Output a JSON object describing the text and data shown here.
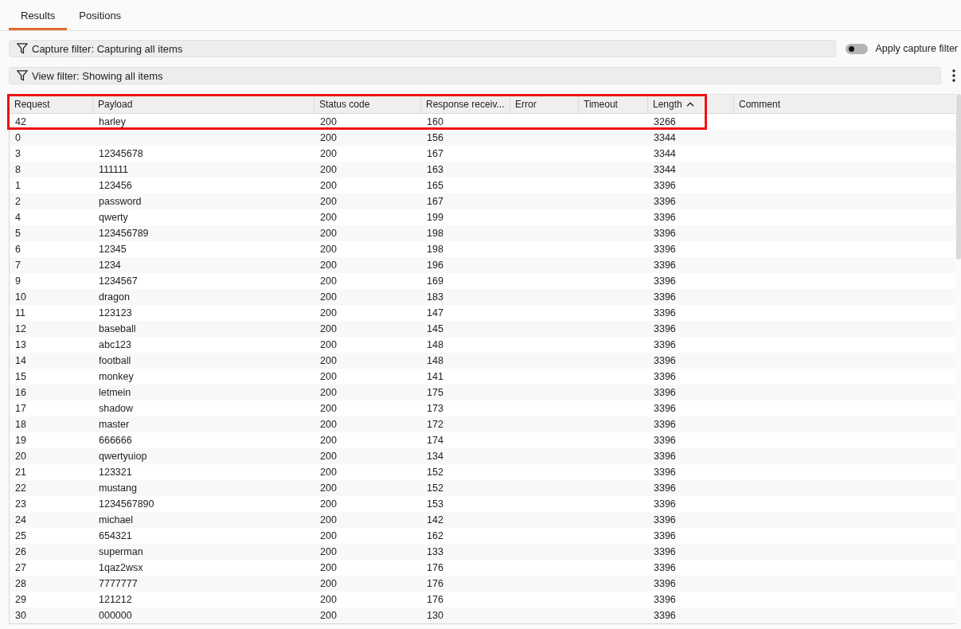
{
  "tabs": [
    {
      "label": "Results",
      "selected": true
    },
    {
      "label": "Positions",
      "selected": false
    }
  ],
  "capture_filter": {
    "label": "Capture filter: Capturing all items"
  },
  "apply_capture_filter": {
    "label": "Apply capture filter",
    "on": false
  },
  "view_filter": {
    "label": "View filter: Showing all items"
  },
  "table": {
    "columns": [
      {
        "label": "Request",
        "sorted": false
      },
      {
        "label": "Payload",
        "sorted": false
      },
      {
        "label": "Status code",
        "sorted": false
      },
      {
        "label": "Response receiv...",
        "sorted": false
      },
      {
        "label": "Error",
        "sorted": false
      },
      {
        "label": "Timeout",
        "sorted": false
      },
      {
        "label": "Length",
        "sorted": true
      },
      {
        "label": "Comment",
        "sorted": false
      }
    ],
    "rows": [
      {
        "request": "42",
        "payload": "harley",
        "status_code": "200",
        "response_received": "160",
        "length": "3266",
        "highlighted": true
      },
      {
        "request": "0",
        "status_code": "200",
        "response_received": "156",
        "length": "3344",
        "highlighted": false
      },
      {
        "request": "3",
        "payload": "12345678",
        "status_code": "200",
        "response_received": "167",
        "length": "3344",
        "highlighted": false
      },
      {
        "request": "8",
        "payload": "111111",
        "status_code": "200",
        "response_received": "163",
        "length": "3344",
        "highlighted": false
      },
      {
        "request": "1",
        "payload": "123456",
        "status_code": "200",
        "response_received": "165",
        "length": "3396",
        "highlighted": false
      },
      {
        "request": "2",
        "payload": "password",
        "status_code": "200",
        "response_received": "167",
        "length": "3396",
        "highlighted": false
      },
      {
        "request": "4",
        "payload": "qwerty",
        "status_code": "200",
        "response_received": "199",
        "length": "3396",
        "highlighted": false
      },
      {
        "request": "5",
        "payload": "123456789",
        "status_code": "200",
        "response_received": "198",
        "length": "3396",
        "highlighted": false
      },
      {
        "request": "6",
        "payload": "12345",
        "status_code": "200",
        "response_received": "198",
        "length": "3396",
        "highlighted": false
      },
      {
        "request": "7",
        "payload": "1234",
        "status_code": "200",
        "response_received": "196",
        "length": "3396",
        "highlighted": false
      },
      {
        "request": "9",
        "payload": "1234567",
        "status_code": "200",
        "response_received": "169",
        "length": "3396",
        "highlighted": false
      },
      {
        "request": "10",
        "payload": "dragon",
        "status_code": "200",
        "response_received": "183",
        "length": "3396",
        "highlighted": false
      },
      {
        "request": "11",
        "payload": "123123",
        "status_code": "200",
        "response_received": "147",
        "length": "3396",
        "highlighted": false
      },
      {
        "request": "12",
        "payload": "baseball",
        "status_code": "200",
        "response_received": "145",
        "length": "3396",
        "highlighted": false
      },
      {
        "request": "13",
        "payload": "abc123",
        "status_code": "200",
        "response_received": "148",
        "length": "3396",
        "highlighted": false
      },
      {
        "request": "14",
        "payload": "football",
        "status_code": "200",
        "response_received": "148",
        "length": "3396",
        "highlighted": false
      },
      {
        "request": "15",
        "payload": "monkey",
        "status_code": "200",
        "response_received": "141",
        "length": "3396",
        "highlighted": false
      },
      {
        "request": "16",
        "payload": "letmein",
        "status_code": "200",
        "response_received": "175",
        "length": "3396",
        "highlighted": false
      },
      {
        "request": "17",
        "payload": "shadow",
        "status_code": "200",
        "response_received": "173",
        "length": "3396",
        "highlighted": false
      },
      {
        "request": "18",
        "payload": "master",
        "status_code": "200",
        "response_received": "172",
        "length": "3396",
        "highlighted": false
      },
      {
        "request": "19",
        "payload": "666666",
        "status_code": "200",
        "response_received": "174",
        "length": "3396",
        "highlighted": false
      },
      {
        "request": "20",
        "payload": "qwertyuiop",
        "status_code": "200",
        "response_received": "134",
        "length": "3396",
        "highlighted": false
      },
      {
        "request": "21",
        "payload": "123321",
        "status_code": "200",
        "response_received": "152",
        "length": "3396",
        "highlighted": false
      },
      {
        "request": "22",
        "payload": "mustang",
        "status_code": "200",
        "response_received": "152",
        "length": "3396",
        "highlighted": false
      },
      {
        "request": "23",
        "payload": "1234567890",
        "status_code": "200",
        "response_received": "153",
        "length": "3396",
        "highlighted": false
      },
      {
        "request": "24",
        "payload": "michael",
        "status_code": "200",
        "response_received": "142",
        "length": "3396",
        "highlighted": false
      },
      {
        "request": "25",
        "payload": "654321",
        "status_code": "200",
        "response_received": "162",
        "length": "3396",
        "highlighted": false
      },
      {
        "request": "26",
        "payload": "superman",
        "status_code": "200",
        "response_received": "133",
        "length": "3396",
        "highlighted": false
      },
      {
        "request": "27",
        "payload": "1qaz2wsx",
        "status_code": "200",
        "response_received": "176",
        "length": "3396",
        "highlighted": false
      },
      {
        "request": "28",
        "payload": "7777777",
        "status_code": "200",
        "response_received": "176",
        "length": "3396",
        "highlighted": false
      },
      {
        "request": "29",
        "payload": "121212",
        "status_code": "200",
        "response_received": "176",
        "length": "3396",
        "highlighted": false
      },
      {
        "request": "30",
        "payload": "000000",
        "status_code": "200",
        "response_received": "130",
        "length": "3396",
        "highlighted": false
      }
    ]
  }
}
